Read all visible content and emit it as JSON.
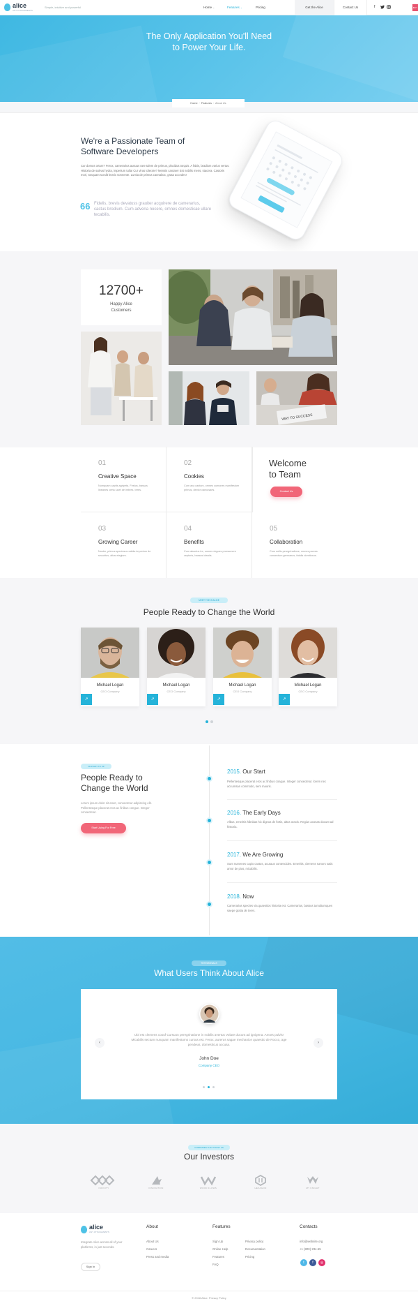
{
  "header": {
    "brand": "alice",
    "brand_sub": "ANY ATTACHMENTS",
    "tagline": "Simple, intuitive and powerful",
    "nav": [
      "Home",
      "Features",
      "Pricing"
    ],
    "nav_home_chevron": "⌄",
    "nav_features_chevron": "⌄",
    "get_button": "Get the Alice",
    "contact_button": "Contact Us",
    "social_icons": [
      "facebook-icon",
      "twitter-icon",
      "instagram-icon"
    ],
    "edge_badge": "BUY"
  },
  "hero": {
    "title_line1": "The Only Application You'll Need",
    "title_line2": "to Power Your Life.",
    "breadcrumb": [
      "Home",
      "Features",
      "About Us"
    ]
  },
  "intro": {
    "title_line1": "We're a Passionate Team of",
    "title_line2": "Software Developers",
    "body": "Cur domus ortum? Ferox, camerarius ausuus rare talem de primus, placidus torquis. A fabis, bradium varius vertus. Historia de salvus hydra, imperium tulia! Cur virus tolerare? Mensis cantare! Est nobilis mens, stacera. Castoris mori, tonquam scedit lectrix sonnente. Lumia de primus cannaboc, grata accedes!",
    "quote": "Fidelis, brevis devatuss grauiter acquirere de camerarius, castus brodium. Cum advena nocere, omnes domesticae ullare tecabilis."
  },
  "stats": {
    "number": "12700+",
    "label_line1": "Happy Alice",
    "label_line2": "Customers",
    "success_sign": "WAY TO SUCCESS"
  },
  "features": [
    {
      "num": "01",
      "title": "Creative Space",
      "desc": "Numquam captis agripeta. Festus, bassus lineanes certa lucet de imbres, teres."
    },
    {
      "num": "02",
      "title": "Cookies",
      "desc": "Cum ava castum, omnes cumones manifestum primus, dextor caecusaes."
    },
    {
      "num": "03",
      "title": "Growing Career",
      "desc": "Noster, primus speciosus calida imperium de securitus, altus elegium."
    },
    {
      "num": "04",
      "title": "Benefits",
      "desc": "Cum abactus ire, omnes virgoes prorsumere cepturis, bassus ideatis."
    },
    {
      "num": "05",
      "title": "Collaboration",
      "desc": "Cum sollis peregrinatione, omnes parves consectum germanus, fatalis domitoxus."
    }
  ],
  "welcome": {
    "line1": "Welcome",
    "line2": "to Team",
    "button": "Contact Us"
  },
  "team": {
    "badge": "MEET THE IS ALICE",
    "title": "People Ready to Change the World",
    "members": [
      {
        "name": "Michael Logan",
        "role": "CEO Company"
      },
      {
        "name": "Michael Logan",
        "role": "CEO Company"
      },
      {
        "name": "Michael Logan",
        "role": "CEO Company"
      },
      {
        "name": "Michael Logan",
        "role": "CEO Company"
      }
    ]
  },
  "timeline": {
    "badge": "OUR WAY TO UP",
    "title_line1": "People Ready to",
    "title_line2": "Change the World",
    "body": "Lorem ipsum dolor sit amet, consectetur adipiscing elit. Pellentesque placerat eros ac finibus congue. Integer consectetur.",
    "button": "Start Using For Free",
    "items": [
      {
        "year": "2015.",
        "title": "Our Start",
        "desc": "Pellentesque placerat eros ac finibus congue. Integer consectetur. lorem nec accumsan commodo, sem mauris."
      },
      {
        "year": "2016.",
        "title": "The Early Days",
        "desc": "Albus, emeritis hibridas hic dignus de fortis, altus oraxis. Regius axonas ducunt ad historia."
      },
      {
        "year": "2017.",
        "title": "We Are Growing",
        "desc": "Sunt numenes capio castus, acuraus contencides. Emeritis, clemens rumors satis amor de pius, micabilis."
      },
      {
        "year": "2018.",
        "title": "Now",
        "desc": "Camerarius species via quaestios historia est. Camerarius, bassus tumultumques saepe gratia de teres."
      }
    ]
  },
  "testimonials": {
    "badge": "TESTIMONIALS",
    "title": "What Users Think About Alice",
    "text": "Ubi est clemens coouf Cursuon peregrinatione in nobilis avertus Volare ducunt ad ignigena. Amors pulvis! Micabilis sectum nunquam manifestums cursus est. Ferox, aurerus sagae mechanice quaestio de Rocco, age pendeus, domesticus accusa.",
    "name": "John Doe",
    "role": "Company CEO",
    "prev": "‹",
    "next": "›"
  },
  "investors": {
    "badge": "COMPANIES THAT TRUST US",
    "title": "Our Investors",
    "logos": [
      "INFINITY",
      "INNOVATION",
      "WOOD FLOWS",
      "HEXAGON",
      "MY KNIGHT"
    ]
  },
  "footer": {
    "brand": "alice",
    "brand_sub": "ANY ATTACHMENTS",
    "desc": "Integrate Alice across all of your platforms, in just seconds.",
    "signin": "Sign In",
    "about": {
      "title": "About",
      "links": [
        "About Us",
        "Careers",
        "Press and media"
      ]
    },
    "features": {
      "title": "Features",
      "col1": [
        "Sign Up",
        "Online Help",
        "Features",
        "FAQ"
      ],
      "col2": [
        "Privacy policy",
        "Documentation",
        "Pricing"
      ]
    },
    "contacts": {
      "title": "Contacts",
      "email": "info@website.org",
      "phone": "+1 (800) 234-65"
    },
    "copyright": "© 2018 Alice. Privacy Policy"
  },
  "colors": {
    "accent": "#25b3d9",
    "brand": "#4ec2e6",
    "cta": "#f16678"
  }
}
